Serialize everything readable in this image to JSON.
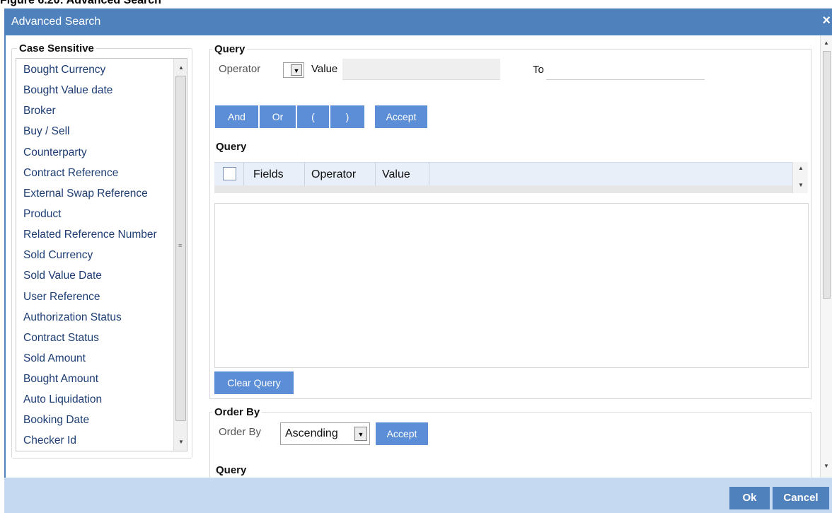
{
  "caption": "Figure 6.20: Advanced Search",
  "window": {
    "title": "Advanced Search",
    "close_glyph": "×"
  },
  "left_panel": {
    "legend": "Case Sensitive",
    "fields": [
      "Bought Currency",
      "Bought Value date",
      "Broker",
      "Buy / Sell",
      "Counterparty",
      "Contract Reference",
      "External Swap Reference",
      "Product",
      "Related Reference Number",
      "Sold Currency",
      "Sold Value Date",
      "User Reference",
      "Authorization Status",
      "Contract Status",
      "Sold Amount",
      "Bought Amount",
      "Auto Liquidation",
      "Booking Date",
      "Checker Id"
    ]
  },
  "query_section": {
    "legend": "Query",
    "operator_label": "Operator",
    "operator_value": "",
    "value_label": "Value",
    "value_value": "",
    "to_label": "To",
    "to_value": "",
    "buttons": {
      "and": "And",
      "or": "Or",
      "open_paren": "(",
      "close_paren": ")",
      "accept": "Accept"
    },
    "table_title": "Query",
    "columns": [
      "Fields",
      "Operator",
      "Value"
    ],
    "rows": [],
    "clear_query": "Clear Query"
  },
  "order_section": {
    "legend": "Order By",
    "order_by_label": "Order By",
    "order_value": "Ascending",
    "accept": "Accept",
    "next_legend": "Query"
  },
  "footer": {
    "ok": "Ok",
    "cancel": "Cancel"
  },
  "icons": {
    "dropdown": "chevron-down-icon",
    "scroll_up": "arrow-up-icon",
    "scroll_down": "arrow-down-icon",
    "close": "close-icon"
  },
  "colors": {
    "titlebar": "#4f81bd",
    "button": "#5b8ed6",
    "footer": "#c5d9f1",
    "field_text": "#1d3d73"
  }
}
